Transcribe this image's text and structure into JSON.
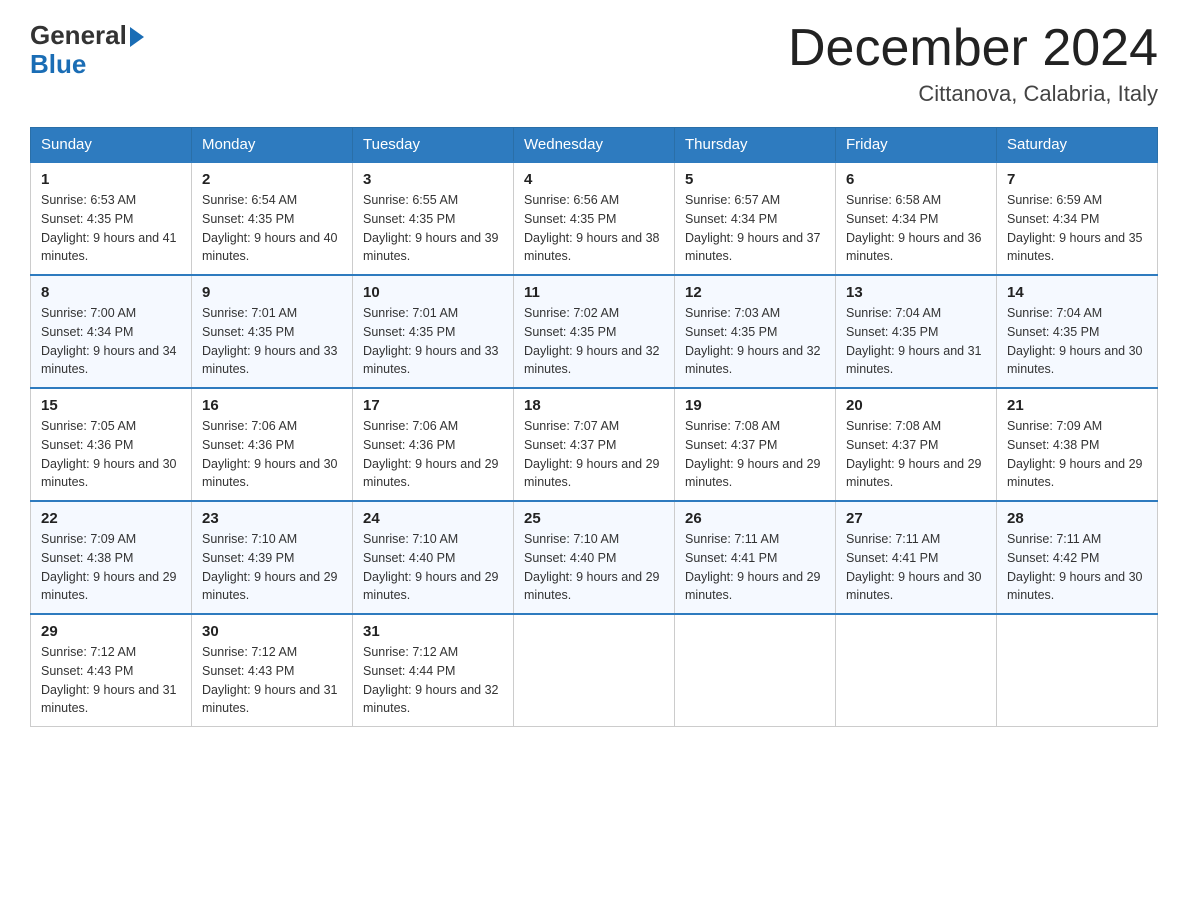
{
  "header": {
    "logo_general": "General",
    "logo_blue": "Blue",
    "month_title": "December 2024",
    "location": "Cittanova, Calabria, Italy"
  },
  "calendar": {
    "days_of_week": [
      "Sunday",
      "Monday",
      "Tuesday",
      "Wednesday",
      "Thursday",
      "Friday",
      "Saturday"
    ],
    "weeks": [
      [
        {
          "day": "1",
          "sunrise": "6:53 AM",
          "sunset": "4:35 PM",
          "daylight": "9 hours and 41 minutes."
        },
        {
          "day": "2",
          "sunrise": "6:54 AM",
          "sunset": "4:35 PM",
          "daylight": "9 hours and 40 minutes."
        },
        {
          "day": "3",
          "sunrise": "6:55 AM",
          "sunset": "4:35 PM",
          "daylight": "9 hours and 39 minutes."
        },
        {
          "day": "4",
          "sunrise": "6:56 AM",
          "sunset": "4:35 PM",
          "daylight": "9 hours and 38 minutes."
        },
        {
          "day": "5",
          "sunrise": "6:57 AM",
          "sunset": "4:34 PM",
          "daylight": "9 hours and 37 minutes."
        },
        {
          "day": "6",
          "sunrise": "6:58 AM",
          "sunset": "4:34 PM",
          "daylight": "9 hours and 36 minutes."
        },
        {
          "day": "7",
          "sunrise": "6:59 AM",
          "sunset": "4:34 PM",
          "daylight": "9 hours and 35 minutes."
        }
      ],
      [
        {
          "day": "8",
          "sunrise": "7:00 AM",
          "sunset": "4:34 PM",
          "daylight": "9 hours and 34 minutes."
        },
        {
          "day": "9",
          "sunrise": "7:01 AM",
          "sunset": "4:35 PM",
          "daylight": "9 hours and 33 minutes."
        },
        {
          "day": "10",
          "sunrise": "7:01 AM",
          "sunset": "4:35 PM",
          "daylight": "9 hours and 33 minutes."
        },
        {
          "day": "11",
          "sunrise": "7:02 AM",
          "sunset": "4:35 PM",
          "daylight": "9 hours and 32 minutes."
        },
        {
          "day": "12",
          "sunrise": "7:03 AM",
          "sunset": "4:35 PM",
          "daylight": "9 hours and 32 minutes."
        },
        {
          "day": "13",
          "sunrise": "7:04 AM",
          "sunset": "4:35 PM",
          "daylight": "9 hours and 31 minutes."
        },
        {
          "day": "14",
          "sunrise": "7:04 AM",
          "sunset": "4:35 PM",
          "daylight": "9 hours and 30 minutes."
        }
      ],
      [
        {
          "day": "15",
          "sunrise": "7:05 AM",
          "sunset": "4:36 PM",
          "daylight": "9 hours and 30 minutes."
        },
        {
          "day": "16",
          "sunrise": "7:06 AM",
          "sunset": "4:36 PM",
          "daylight": "9 hours and 30 minutes."
        },
        {
          "day": "17",
          "sunrise": "7:06 AM",
          "sunset": "4:36 PM",
          "daylight": "9 hours and 29 minutes."
        },
        {
          "day": "18",
          "sunrise": "7:07 AM",
          "sunset": "4:37 PM",
          "daylight": "9 hours and 29 minutes."
        },
        {
          "day": "19",
          "sunrise": "7:08 AM",
          "sunset": "4:37 PM",
          "daylight": "9 hours and 29 minutes."
        },
        {
          "day": "20",
          "sunrise": "7:08 AM",
          "sunset": "4:37 PM",
          "daylight": "9 hours and 29 minutes."
        },
        {
          "day": "21",
          "sunrise": "7:09 AM",
          "sunset": "4:38 PM",
          "daylight": "9 hours and 29 minutes."
        }
      ],
      [
        {
          "day": "22",
          "sunrise": "7:09 AM",
          "sunset": "4:38 PM",
          "daylight": "9 hours and 29 minutes."
        },
        {
          "day": "23",
          "sunrise": "7:10 AM",
          "sunset": "4:39 PM",
          "daylight": "9 hours and 29 minutes."
        },
        {
          "day": "24",
          "sunrise": "7:10 AM",
          "sunset": "4:40 PM",
          "daylight": "9 hours and 29 minutes."
        },
        {
          "day": "25",
          "sunrise": "7:10 AM",
          "sunset": "4:40 PM",
          "daylight": "9 hours and 29 minutes."
        },
        {
          "day": "26",
          "sunrise": "7:11 AM",
          "sunset": "4:41 PM",
          "daylight": "9 hours and 29 minutes."
        },
        {
          "day": "27",
          "sunrise": "7:11 AM",
          "sunset": "4:41 PM",
          "daylight": "9 hours and 30 minutes."
        },
        {
          "day": "28",
          "sunrise": "7:11 AM",
          "sunset": "4:42 PM",
          "daylight": "9 hours and 30 minutes."
        }
      ],
      [
        {
          "day": "29",
          "sunrise": "7:12 AM",
          "sunset": "4:43 PM",
          "daylight": "9 hours and 31 minutes."
        },
        {
          "day": "30",
          "sunrise": "7:12 AM",
          "sunset": "4:43 PM",
          "daylight": "9 hours and 31 minutes."
        },
        {
          "day": "31",
          "sunrise": "7:12 AM",
          "sunset": "4:44 PM",
          "daylight": "9 hours and 32 minutes."
        },
        null,
        null,
        null,
        null
      ]
    ]
  }
}
